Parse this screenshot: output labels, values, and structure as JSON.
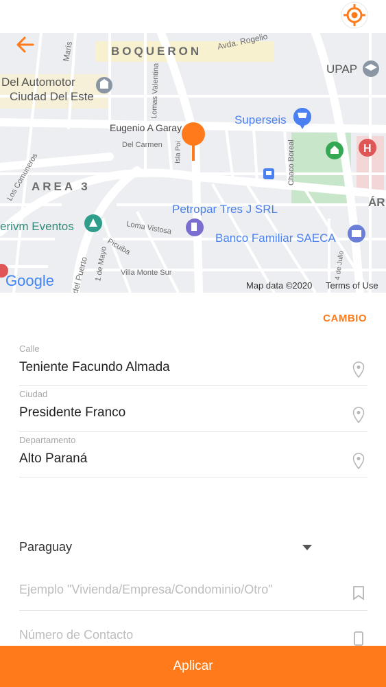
{
  "colors": {
    "accent": "#ff7a1a",
    "map_bg": "#eceef1",
    "park": "#c8e6c9",
    "poi_blue": "#4a80f0"
  },
  "header": {
    "back_icon": "arrow-left-icon",
    "location_icon": "crosshair-icon"
  },
  "map": {
    "labels": {
      "boqueron": "BOQUERON",
      "avda_rogelio": "Avda. Rogelio",
      "upap": "UPAP",
      "del_automotor": "Del Automotor",
      "ciudad_del_este": "Ciudad Del Este",
      "mariscal": "Maris",
      "lomas_valentina": "Lomas Valentina",
      "superseis": "Superseis",
      "eugenio": "Eugenio A Garay",
      "del_carmen": "Del Carmen",
      "isla_poi": "Isla Poi",
      "chaco_boreal": "Chaco Boreal",
      "los_comuneros": "Los Comuneros",
      "area3": "AREA 3",
      "area_right": "ÁR",
      "petropar": "Petropar Tres J SRL",
      "loma_vistosa": "Loma Vistosa",
      "banco": "Banco Familiar SAECA",
      "erivm": "erivm Eventos",
      "picuiba": "Picuiba",
      "del_puerto": "del Puerto",
      "mayo": "1 de Mayo",
      "villa_monte": "Villa Monte Sur",
      "julio": "4 de Julio",
      "google": "Google",
      "map_data": "Map data ©2020",
      "terms": "Terms of Use"
    }
  },
  "cambio_label": "CAMBIO",
  "fields": {
    "calle": {
      "label": "Calle",
      "value": "Teniente Facundo Almada"
    },
    "ciudad": {
      "label": "Ciudad",
      "value": "Presidente Franco"
    },
    "departamento": {
      "label": "Departamento",
      "value": "Alto Paraná"
    }
  },
  "country": {
    "selected": "Paraguay"
  },
  "reference": {
    "placeholder": "Ejemplo \"Vivienda/Empresa/Condominio/Otro\""
  },
  "contact": {
    "placeholder": "Número de Contacto"
  },
  "apply_label": "Aplicar"
}
